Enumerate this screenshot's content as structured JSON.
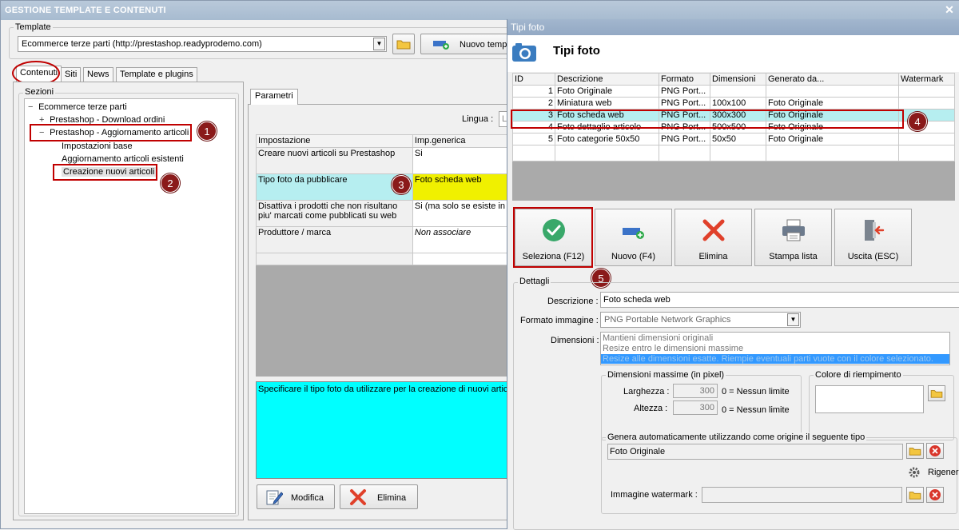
{
  "main": {
    "title": "GESTIONE TEMPLATE E CONTENUTI",
    "close_symbol": "✕",
    "template_label": "Template",
    "template_value": "Ecommerce terze parti (http://prestashop.readyprodemo.com)",
    "new_template_label": "Nuovo temp",
    "tabs": [
      "Contenuti",
      "Siti",
      "News",
      "Template e plugins"
    ],
    "sections_label": "Sezioni",
    "tree": {
      "root": "Ecommerce terze parti",
      "root_toggle": "−",
      "node1": "Prestashop - Download ordini",
      "node1_toggle": "+",
      "node2": "Prestashop - Aggiornamento articoli",
      "node2_toggle": "−",
      "children": [
        "Impostazioni base",
        "Aggiornamento articoli esistenti",
        "Creazione nuovi articoli"
      ]
    },
    "params_tab": "Parametri",
    "lingua_label": "Lingua :",
    "lingua_value": "L",
    "grid": {
      "headers": [
        "Impostazione",
        "Imp.generica"
      ],
      "rows": [
        {
          "setting": "Creare nuovi articoli su Prestashop",
          "value": "Si"
        },
        {
          "setting": "Tipo foto da pubblicare",
          "value": "Foto scheda web"
        },
        {
          "setting": "Disattiva i prodotti che non risultano piu' marcati come pubblicati su web",
          "value": "Si (ma solo se esiste in"
        },
        {
          "setting": "Produttore / marca",
          "value": "Non associare"
        }
      ]
    },
    "description_text": "Specificare il tipo foto da utilizzare per la creazione di nuovi artico",
    "modify_label": "Modifica",
    "delete_label": "Elimina"
  },
  "markers": [
    "1",
    "2",
    "3",
    "4",
    "5"
  ],
  "dialog": {
    "title": "Tipi foto",
    "heading": "Tipi foto",
    "grid": {
      "headers": [
        "ID",
        "Descrizione",
        "Formato",
        "Dimensioni",
        "Generato da...",
        "Watermark"
      ],
      "rows": [
        {
          "id": "1",
          "desc": "Foto Originale",
          "format": "PNG Port...",
          "dim": "",
          "gen": "",
          "wm": ""
        },
        {
          "id": "2",
          "desc": "Miniatura web",
          "format": "PNG Port...",
          "dim": "100x100",
          "gen": "Foto Originale",
          "wm": ""
        },
        {
          "id": "3",
          "desc": "Foto scheda web",
          "format": "PNG Port...",
          "dim": "300x300",
          "gen": "Foto Originale",
          "wm": ""
        },
        {
          "id": "4",
          "desc": "Foto dettaglio articolo",
          "format": "PNG Port...",
          "dim": "500x500",
          "gen": "Foto Originale",
          "wm": ""
        },
        {
          "id": "5",
          "desc": "Foto categorie 50x50",
          "format": "PNG Port...",
          "dim": "50x50",
          "gen": "Foto Originale",
          "wm": ""
        }
      ]
    },
    "toolbar": {
      "select": "Seleziona (F12)",
      "new": "Nuovo (F4)",
      "delete": "Elimina",
      "print": "Stampa lista",
      "exit": "Uscita (ESC)"
    },
    "details": {
      "legend": "Dettagli",
      "descrizione_label": "Descrizione :",
      "descrizione_value": "Foto scheda web",
      "formato_label": "Formato immagine :",
      "formato_value": "PNG Portable Network Graphics",
      "dimensioni_label": "Dimensioni :",
      "dimensioni_options": [
        "Mantieni dimensioni originali",
        "Resize entro le dimensioni massime",
        "Resize alle dimensioni esatte. Riempie eventuali parti vuote con il colore selezionato."
      ],
      "max_dim_legend": "Dimensioni massime (in pixel)",
      "larghezza_label": "Larghezza :",
      "larghezza_value": "300",
      "larghezza_note": "0 = Nessun limite",
      "altezza_label": "Altezza :",
      "altezza_value": "300",
      "altezza_note": "0 = Nessun limite",
      "fill_color_legend": "Colore di riempimento",
      "genera_legend": "Genera automaticamente utilizzando come origine il seguente tipo",
      "genera_value": "Foto Originale",
      "rigenera_label": "Rigenera",
      "watermark_label": "Immagine watermark :",
      "watermark_value": ""
    }
  },
  "colors": {
    "highlight_row": "#b6eef0",
    "yellow_cell": "#f0f000",
    "cyan_panel": "#00ffff",
    "marker": "#8a1a1a",
    "redbox": "#c00000",
    "selected_option": "#3399ff"
  },
  "icons": [
    "folder-icon",
    "add-icon",
    "camera-icon",
    "check-icon",
    "delete-x-icon",
    "printer-icon",
    "exit-door-icon",
    "edit-icon",
    "gear-icon"
  ]
}
